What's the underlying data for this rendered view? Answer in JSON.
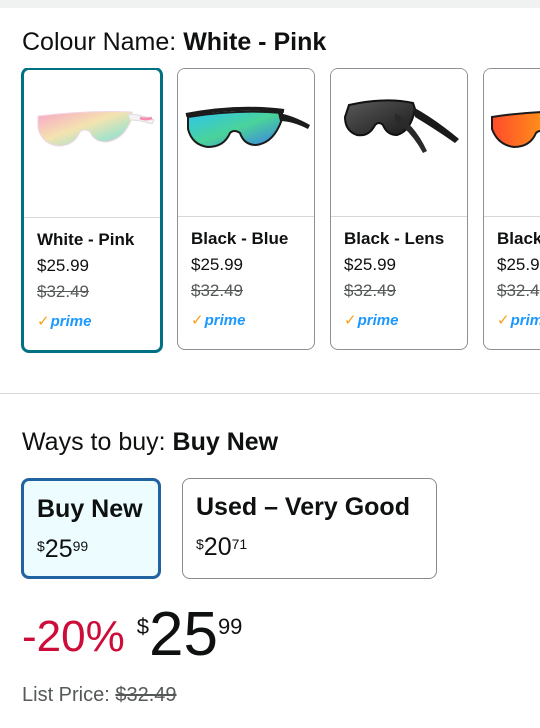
{
  "colour": {
    "label": "Colour Name:",
    "selected": "White - Pink",
    "swatches": [
      {
        "name": "White - Pink",
        "price": "$25.99",
        "was": "$32.49",
        "prime": "prime"
      },
      {
        "name": "Black - Blue",
        "price": "$25.99",
        "was": "$32.49",
        "prime": "prime"
      },
      {
        "name": "Black - Lens",
        "price": "$25.99",
        "was": "$32.49",
        "prime": "prime"
      },
      {
        "name": "Black",
        "price": "$25.9",
        "was": "$32.4",
        "prime": "prim"
      }
    ]
  },
  "ways": {
    "label": "Ways to buy:",
    "selected": "Buy New",
    "options": [
      {
        "label": "Buy New",
        "symbol": "$",
        "whole": "25",
        "fraction": "99"
      },
      {
        "label": "Used – Very Good",
        "symbol": "$",
        "whole": "20",
        "fraction": "71"
      }
    ]
  },
  "price": {
    "discount": "-20%",
    "symbol": "$",
    "whole": "25",
    "fraction": "99"
  },
  "list_price": {
    "label": "List Price:",
    "value": "$32.49"
  },
  "colors": {
    "accent_teal": "#007185",
    "selected_blue": "#2162a1",
    "discount_red": "#cc0c39",
    "prime_blue": "#1a98ff",
    "prime_check": "#f7a116"
  },
  "icons": [
    "prime-check-icon",
    "sunglasses-image"
  ]
}
